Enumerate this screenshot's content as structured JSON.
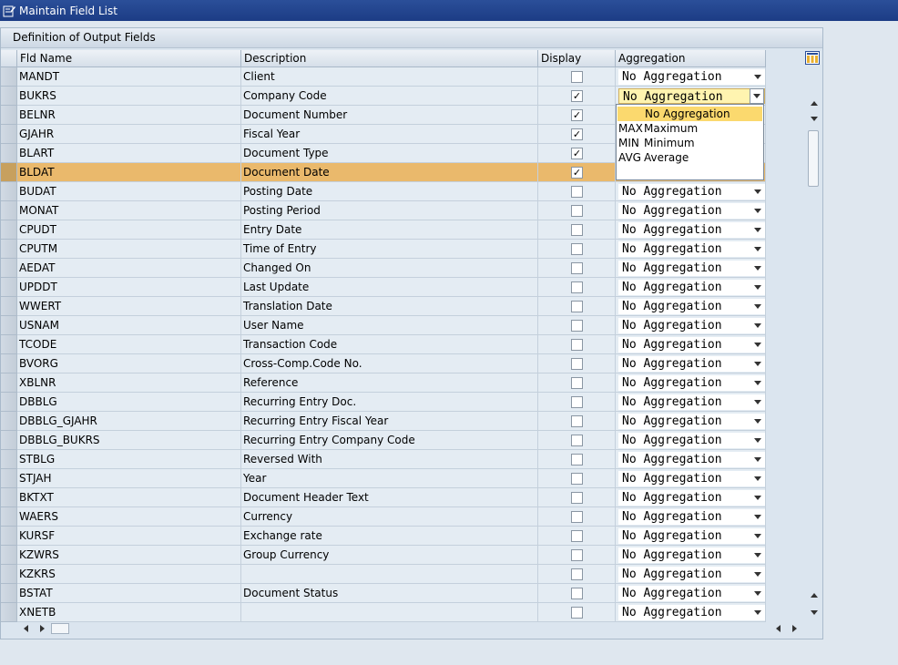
{
  "window": {
    "title": "Maintain Field List"
  },
  "panel": {
    "title": "Definition of Output Fields"
  },
  "columns": {
    "fld_name": "Fld Name",
    "description": "Description",
    "display": "Display",
    "aggregation": "Aggregation"
  },
  "rows": [
    {
      "fld": "MANDT",
      "desc": "Client",
      "display": false,
      "agg": "No Aggregation"
    },
    {
      "fld": "BUKRS",
      "desc": "Company Code",
      "display": true,
      "agg": "No Aggregation"
    },
    {
      "fld": "BELNR",
      "desc": "Document Number",
      "display": true,
      "agg": ""
    },
    {
      "fld": "GJAHR",
      "desc": "Fiscal Year",
      "display": true,
      "agg": ""
    },
    {
      "fld": "BLART",
      "desc": "Document Type",
      "display": true,
      "agg": ""
    },
    {
      "fld": "BLDAT",
      "desc": "Document Date",
      "display": true,
      "agg": ""
    },
    {
      "fld": "BUDAT",
      "desc": "Posting Date",
      "display": false,
      "agg": "No Aggregation"
    },
    {
      "fld": "MONAT",
      "desc": "Posting Period",
      "display": false,
      "agg": "No Aggregation"
    },
    {
      "fld": "CPUDT",
      "desc": "Entry Date",
      "display": false,
      "agg": "No Aggregation"
    },
    {
      "fld": "CPUTM",
      "desc": "Time of Entry",
      "display": false,
      "agg": "No Aggregation"
    },
    {
      "fld": "AEDAT",
      "desc": "Changed On",
      "display": false,
      "agg": "No Aggregation"
    },
    {
      "fld": "UPDDT",
      "desc": "Last Update",
      "display": false,
      "agg": "No Aggregation"
    },
    {
      "fld": "WWERT",
      "desc": "Translation Date",
      "display": false,
      "agg": "No Aggregation"
    },
    {
      "fld": "USNAM",
      "desc": "User Name",
      "display": false,
      "agg": "No Aggregation"
    },
    {
      "fld": "TCODE",
      "desc": "Transaction Code",
      "display": false,
      "agg": "No Aggregation"
    },
    {
      "fld": "BVORG",
      "desc": "Cross-Comp.Code No.",
      "display": false,
      "agg": "No Aggregation"
    },
    {
      "fld": "XBLNR",
      "desc": "Reference",
      "display": false,
      "agg": "No Aggregation"
    },
    {
      "fld": "DBBLG",
      "desc": "Recurring Entry Doc.",
      "display": false,
      "agg": "No Aggregation"
    },
    {
      "fld": "DBBLG_GJAHR",
      "desc": "Recurring Entry Fiscal Year",
      "display": false,
      "agg": "No Aggregation"
    },
    {
      "fld": "DBBLG_BUKRS",
      "desc": "Recurring Entry Company Code",
      "display": false,
      "agg": "No Aggregation"
    },
    {
      "fld": "STBLG",
      "desc": "Reversed With",
      "display": false,
      "agg": "No Aggregation"
    },
    {
      "fld": "STJAH",
      "desc": "Year",
      "display": false,
      "agg": "No Aggregation"
    },
    {
      "fld": "BKTXT",
      "desc": "Document Header Text",
      "display": false,
      "agg": "No Aggregation"
    },
    {
      "fld": "WAERS",
      "desc": "Currency",
      "display": false,
      "agg": "No Aggregation"
    },
    {
      "fld": "KURSF",
      "desc": "Exchange rate",
      "display": false,
      "agg": "No Aggregation"
    },
    {
      "fld": "KZWRS",
      "desc": "Group Currency",
      "display": false,
      "agg": "No Aggregation"
    },
    {
      "fld": "KZKRS",
      "desc": "",
      "display": false,
      "agg": "No Aggregation"
    },
    {
      "fld": "BSTAT",
      "desc": "Document Status",
      "display": false,
      "agg": "No Aggregation"
    },
    {
      "fld": "XNETB",
      "desc": "",
      "display": false,
      "agg": "No Aggregation"
    }
  ],
  "selected_row": "BLDAT",
  "focused_row": "BUKRS",
  "dropdown": {
    "selected": "No Aggregation",
    "options": [
      {
        "code": "MAX",
        "label": "Maximum"
      },
      {
        "code": "MIN",
        "label": "Minimum"
      },
      {
        "code": "AVG",
        "label": "Average"
      }
    ]
  },
  "checkmark_glyph": "✓"
}
